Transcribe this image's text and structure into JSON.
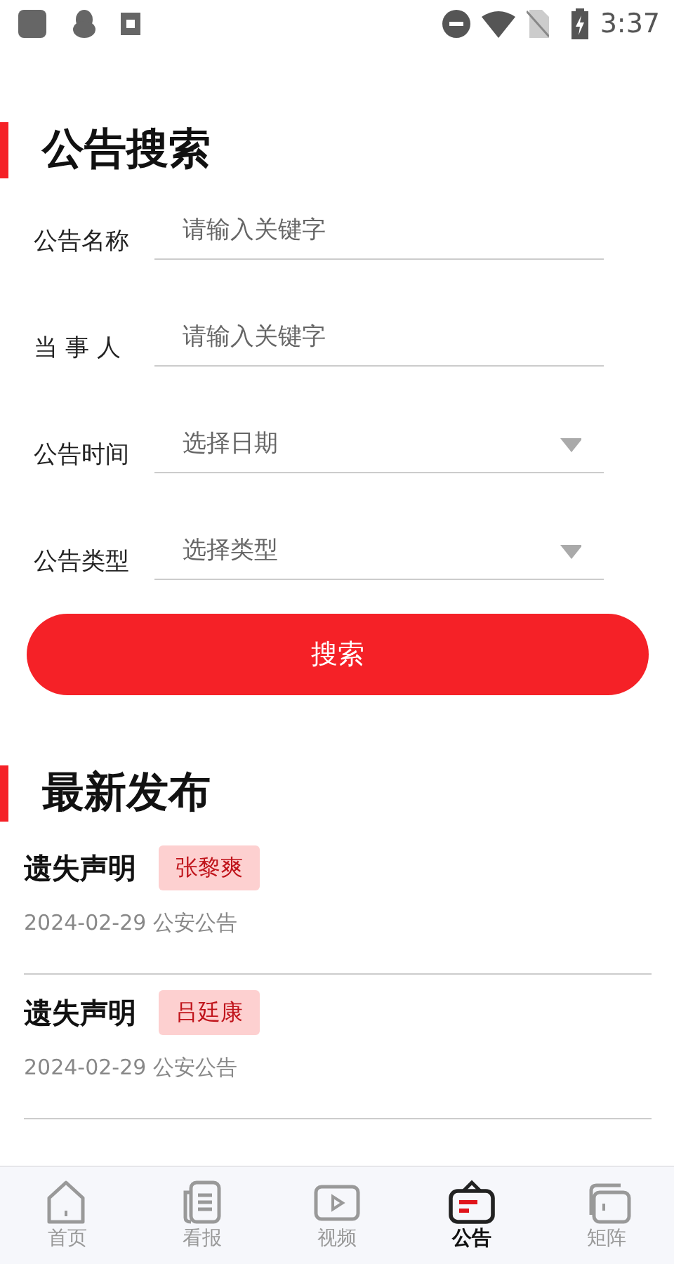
{
  "status_bar": {
    "time": "3:37"
  },
  "search_section": {
    "title": "公告搜索",
    "fields": [
      {
        "kind": "text",
        "label": "公告名称",
        "placeholder": "请输入关键字"
      },
      {
        "kind": "text",
        "label": "当 事 人",
        "placeholder": "请输入关键字"
      },
      {
        "kind": "select",
        "label": "公告时间",
        "placeholder": "选择日期"
      },
      {
        "kind": "select",
        "label": "公告类型",
        "placeholder": "选择类型"
      }
    ],
    "button": "搜索"
  },
  "latest_section": {
    "title": "最新发布",
    "items": [
      {
        "title": "遗失声明",
        "tag": "张黎爽",
        "meta": "2024-02-29 公安公告"
      },
      {
        "title": "遗失声明",
        "tag": "吕廷康",
        "meta": "2024-02-29 公安公告"
      }
    ]
  },
  "bottom_nav": [
    {
      "label": "首页",
      "selected": false
    },
    {
      "label": "看报",
      "selected": false
    },
    {
      "label": "视频",
      "selected": false
    },
    {
      "label": "公告",
      "selected": true
    },
    {
      "label": "矩阵",
      "selected": false
    }
  ]
}
